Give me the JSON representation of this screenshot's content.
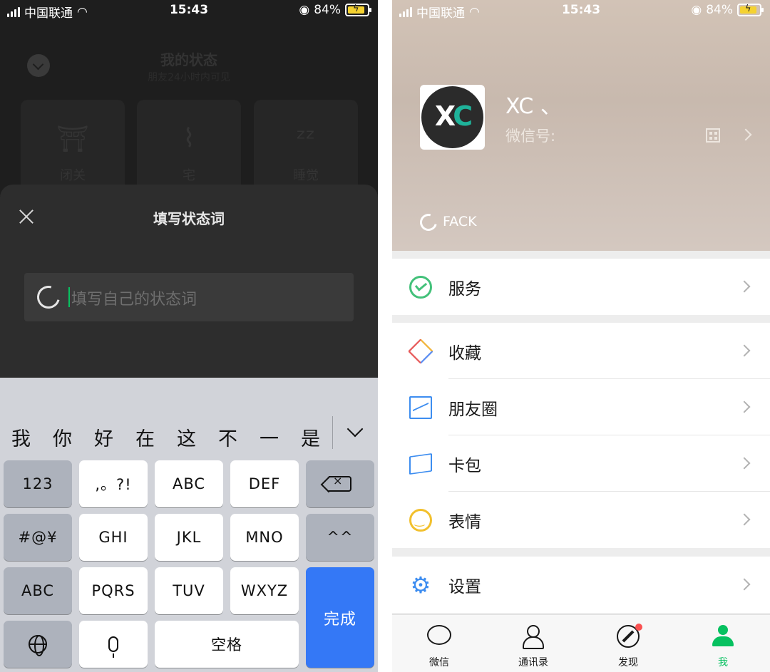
{
  "colors": {
    "wechat_green": "#07c160",
    "keyboard_done_blue": "#3478f6",
    "sheet_dark": "#2d2d2d",
    "notification_red": "#fa5151"
  },
  "left": {
    "status_bar": {
      "carrier": "中国联通",
      "time": "15:43",
      "battery": "84%"
    },
    "background": {
      "title": "我的状态",
      "subtitle": "朋友24小时内可见",
      "statuses": [
        {
          "label": "闭关",
          "icon": "meditation-icon"
        },
        {
          "label": "宅",
          "icon": "lying-icon"
        },
        {
          "label": "睡觉",
          "icon": "sleep-icon"
        }
      ]
    },
    "sheet": {
      "title": "填写状态词",
      "input_placeholder": "填写自己的状态词"
    },
    "keyboard": {
      "candidates": [
        "我",
        "你",
        "好",
        "在",
        "这",
        "不",
        "一",
        "是"
      ],
      "keys": {
        "num": "123",
        "punct": ",。?!",
        "abc_key": "ABC",
        "def_key": "DEF",
        "sym": "#@¥",
        "ghi": "GHI",
        "jkl": "JKL",
        "mno": "MNO",
        "emoji": "^^",
        "abc_switch": "ABC",
        "pqrs": "PQRS",
        "tuv": "TUV",
        "wxyz": "WXYZ",
        "done": "完成",
        "space": "空格"
      }
    }
  },
  "right": {
    "status_bar": {
      "carrier": "中国联通",
      "time": "15:43",
      "battery": "84%"
    },
    "profile": {
      "nickname": "XC 、",
      "wechat_id_label": "微信号:",
      "status_text": "FACK"
    },
    "menu": {
      "service": "服务",
      "favorites": "收藏",
      "moments": "朋友圈",
      "cards": "卡包",
      "stickers": "表情",
      "settings": "设置"
    },
    "tabs": [
      {
        "label": "微信",
        "icon": "chat-bubble-icon"
      },
      {
        "label": "通讯录",
        "icon": "contacts-icon"
      },
      {
        "label": "发现",
        "icon": "compass-icon"
      },
      {
        "label": "我",
        "icon": "person-icon",
        "active": true
      }
    ]
  }
}
